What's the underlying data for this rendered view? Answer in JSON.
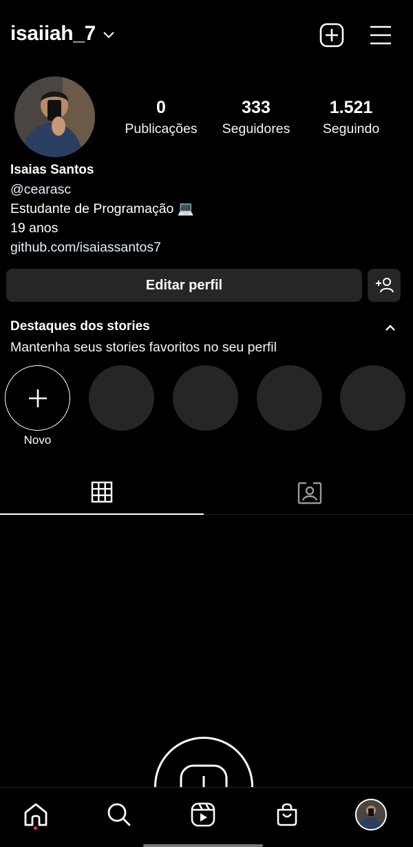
{
  "header": {
    "username": "isaiiah_7"
  },
  "profile": {
    "stats": [
      {
        "value": "0",
        "label": "Publicações"
      },
      {
        "value": "333",
        "label": "Seguidores"
      },
      {
        "value": "1.521",
        "label": "Seguindo"
      }
    ],
    "name": "Isaias Santos",
    "handle": "@cearasc",
    "bio_line1": "Estudante de Programação 💻",
    "bio_line2": "19 anos",
    "link": "github.com/isaiassantos7"
  },
  "actions": {
    "edit_profile": "Editar perfil"
  },
  "highlights": {
    "title": "Destaques dos stories",
    "subtitle": "Mantenha seus stories favoritos no seu perfil",
    "new_label": "Novo"
  },
  "icons": {
    "header": [
      "chevron-down-icon",
      "add-post-icon",
      "menu-icon"
    ],
    "tabs": [
      "grid-icon",
      "tagged-icon"
    ],
    "nav": [
      "home-icon",
      "search-icon",
      "reels-icon",
      "shop-icon",
      "profile-avatar"
    ]
  },
  "colors": {
    "background": "#000000",
    "surface": "#262626",
    "link": "#e0f1ff",
    "notification_dot": "#ff3040"
  }
}
